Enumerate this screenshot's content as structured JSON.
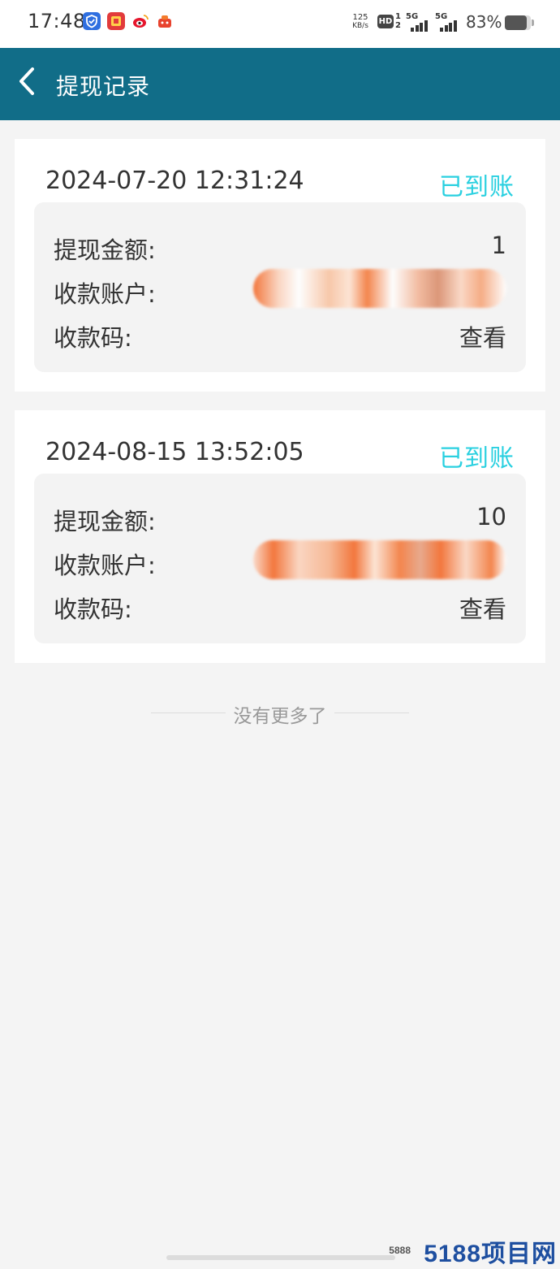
{
  "status_bar": {
    "time": "17:48",
    "speed_value": "125",
    "speed_unit": "KB/s",
    "hd_label": "HD",
    "hd_sub": "1 2",
    "sim1_label": "5G",
    "sim2_label": "5G",
    "battery_percent": "83%",
    "battery_level": 0.83,
    "app_icons": [
      "shield-app-icon",
      "game-app-icon",
      "weibo-app-icon",
      "gift-app-icon"
    ]
  },
  "header": {
    "back_icon": "chevron-left-icon",
    "title": "提现记录",
    "background": "#116d88"
  },
  "records": [
    {
      "time": "2024-07-20 12:31:24",
      "status": "已到账",
      "amount_label": "提现金额:",
      "amount": "1",
      "account_label": "收款账户:",
      "code_label": "收款码:",
      "code_action": "查看"
    },
    {
      "time": "2024-08-15 13:52:05",
      "status": "已到账",
      "amount_label": "提现金额:",
      "amount": "10",
      "account_label": "收款账户:",
      "code_label": "收款码:",
      "code_action": "查看"
    }
  ],
  "footer": {
    "no_more": "没有更多了"
  },
  "watermark": {
    "small": "5888",
    "big": "5188项目网"
  },
  "colors": {
    "status_arrived": "#2ad0e0",
    "page_bg": "#f4f4f4"
  }
}
